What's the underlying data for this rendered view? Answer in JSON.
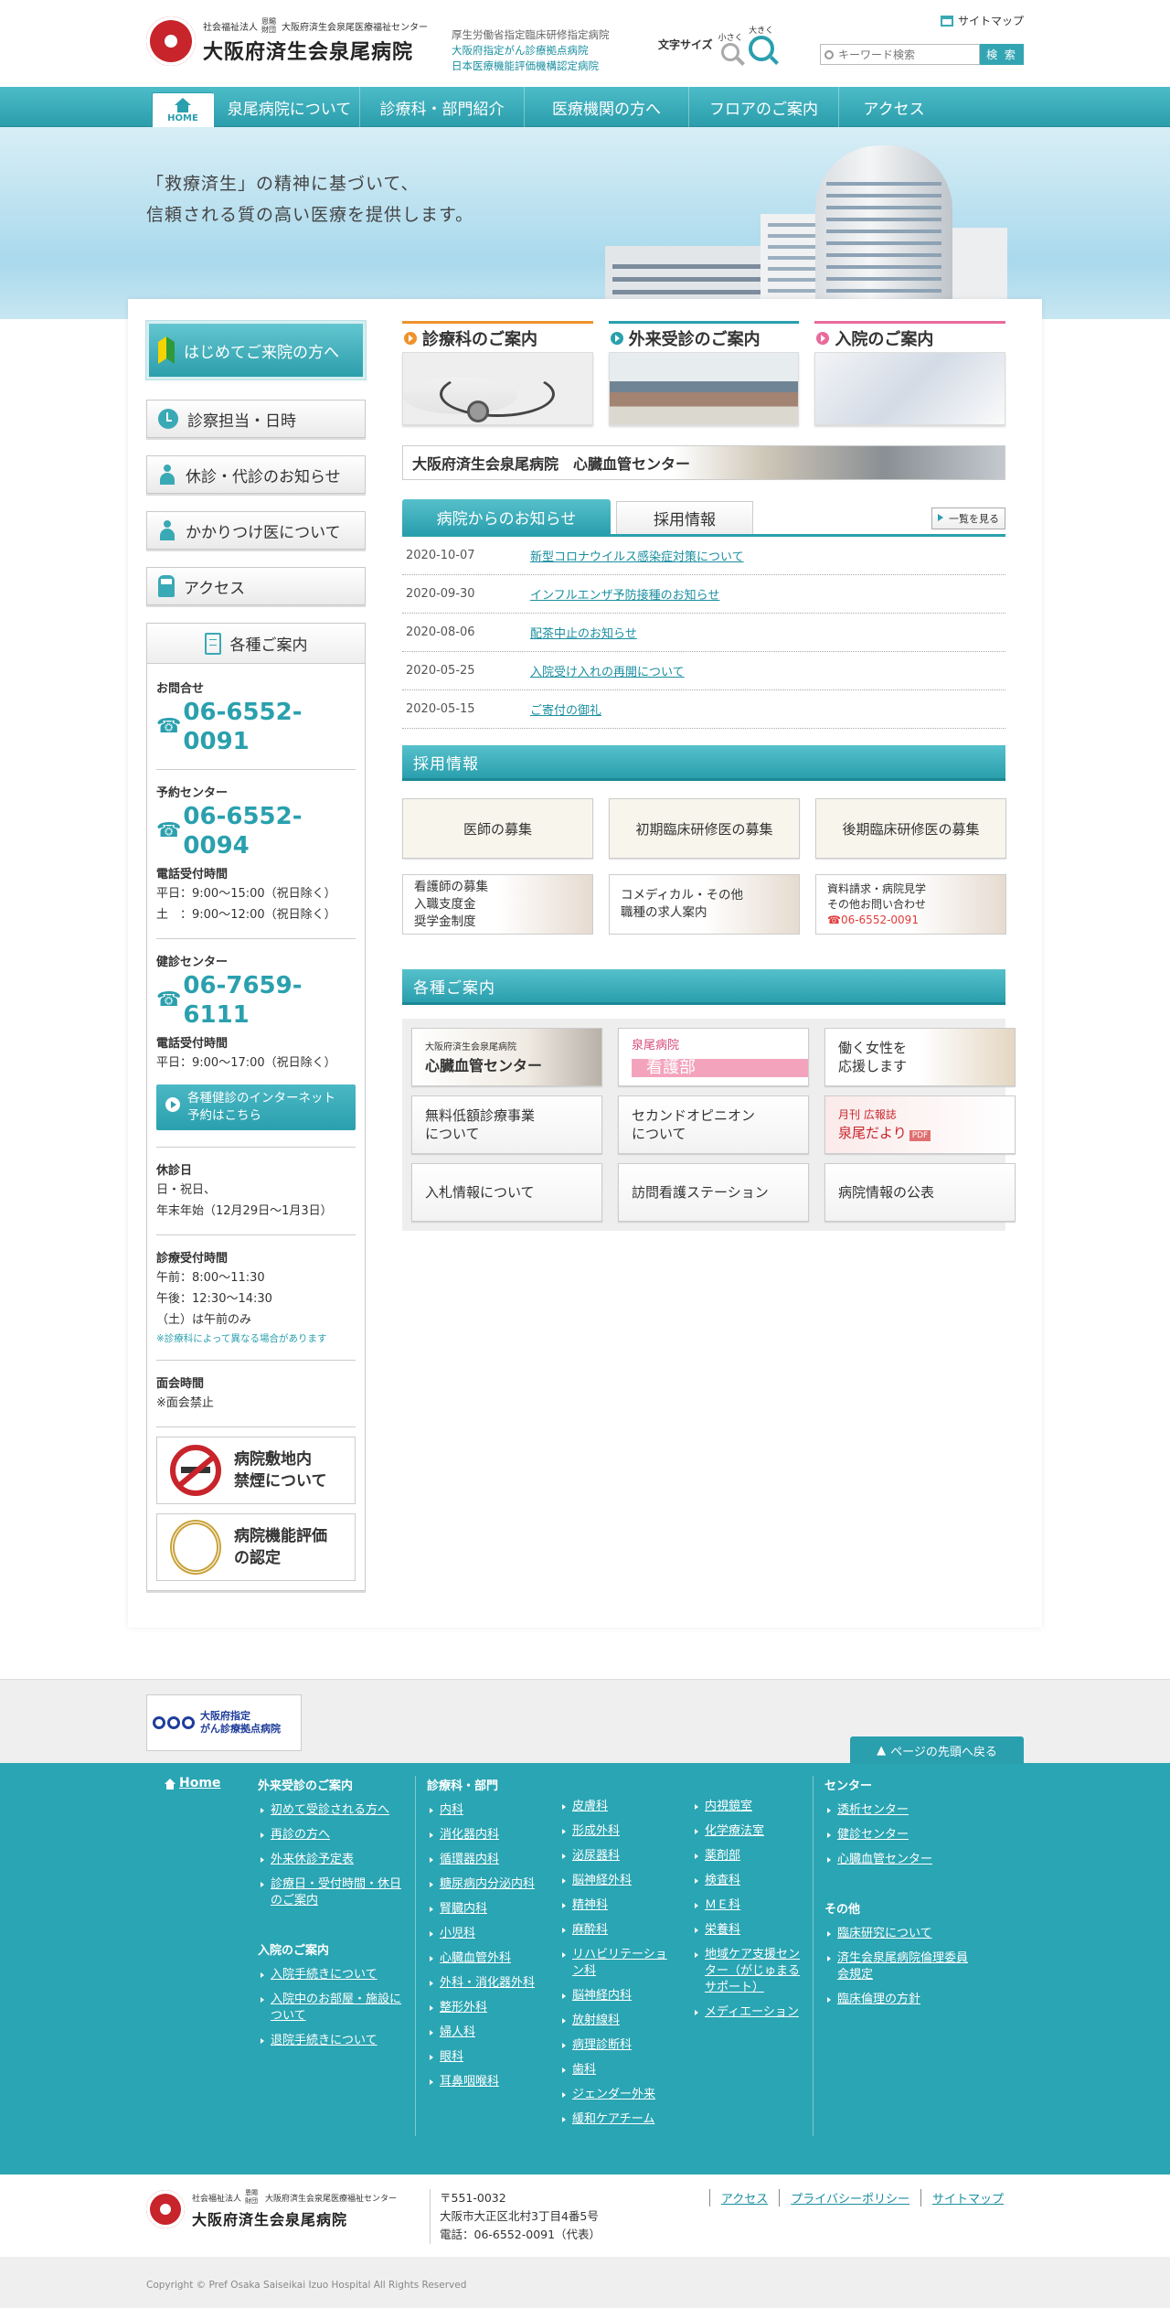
{
  "header": {
    "org_small": "社会福祉法人",
    "org_small2": "恩賜 財団",
    "org_center": "大阪府済生会泉尾医療福祉センター",
    "hospital_name": "大阪府済生会泉尾病院",
    "designations": [
      "厚生労働省指定臨床研修指定病院",
      "大阪府指定がん診療拠点病院",
      "日本医療機能評価機構認定病院"
    ],
    "sitemap": "サイトマップ",
    "font_size_label": "文字サイズ",
    "font_small": "小さく",
    "font_large": "大きく",
    "search_placeholder": "キーワード検索",
    "search_button": "検 索"
  },
  "nav": {
    "home": "HOME",
    "items": [
      "泉尾病院について",
      "診療科・部門紹介",
      "医療機関の方へ",
      "フロアのご案内",
      "アクセス"
    ]
  },
  "hero": {
    "line1": "「救療済生」の精神に基づいて、",
    "line2": "信頼される質の高い医療を提供します。"
  },
  "side": {
    "first_visit": "はじめてご来院の方へ",
    "buttons": [
      "診察担当・日時",
      "休診・代診のお知らせ",
      "かかりつけ医について",
      "アクセス"
    ],
    "info_title": "各種ご案内",
    "inquiry_label": "お問合せ",
    "inquiry_tel": "06-6552-0091",
    "reserve_label": "予約センター",
    "reserve_tel": "06-6552-0094",
    "reserve_hours_label": "電話受付時間",
    "reserve_hours_1": "平日：9:00～15:00（祝日除く）",
    "reserve_hours_2": "土　：9:00～12:00（祝日除く）",
    "checkup_label": "健診センター",
    "checkup_tel": "06-7659-6111",
    "checkup_hours_label": "電話受付時間",
    "checkup_hours_1": "平日：9:00～17:00（祝日除く）",
    "checkup_button_1": "各種健診のインターネット",
    "checkup_button_2": "予約はこちら",
    "closed_label": "休診日",
    "closed_1": "日・祝日、",
    "closed_2": "年末年始（12月29日～1月3日）",
    "reception_label": "診療受付時間",
    "reception_1": "午前：8:00～11:30",
    "reception_2": "午後：12:30～14:30",
    "reception_3": "（土）は午前のみ",
    "reception_note": "※診療科によって異なる場合があります",
    "visit_label": "面会時間",
    "visit_text": "※面会禁止",
    "nosmoke_1": "病院敷地内",
    "nosmoke_2": "禁煙について",
    "eval_1": "病院機能評価",
    "eval_2": "の認定"
  },
  "content": {
    "tri": [
      "診療科のご案内",
      "外来受診のご案内",
      "入院のご案内"
    ],
    "tri_colors": [
      "#f0922b",
      "#2aa0ae",
      "#e96a9c"
    ],
    "heart_banner": "大阪府済生会泉尾病院　心臓血管センター",
    "tab_news": "病院からのお知らせ",
    "tab_recruit": "採用情報",
    "more": "一覧を見る",
    "news": [
      {
        "date": "2020-10-07",
        "title": "新型コロナウイルス感染症対策について"
      },
      {
        "date": "2020-09-30",
        "title": "インフルエンザ予防接種のお知らせ"
      },
      {
        "date": "2020-08-06",
        "title": "配茶中止のお知らせ"
      },
      {
        "date": "2020-05-25",
        "title": "入院受け入れの再開について"
      },
      {
        "date": "2020-05-15",
        "title": "ご寄付の御礼"
      }
    ],
    "recruit_title": "採用情報",
    "recruit": [
      "医師の募集",
      "初期臨床研修医の募集",
      "後期臨床研修医の募集"
    ],
    "recruit_nurse": [
      "看護師の募集",
      "入職支度金",
      "奨学金制度"
    ],
    "recruit_comedical": [
      "コメディカル・その他",
      "職種の求人案内"
    ],
    "recruit_request": [
      "資料請求・病院見学",
      "その他お問い合わせ",
      "☎06-6552-0091"
    ],
    "guide_title": "各種ご案内",
    "guide_heart_small": "大阪府済生会泉尾病院",
    "guide_heart": "心臓血管センター",
    "guide_nurse_small": "泉尾病院",
    "guide_nurse": "看護部",
    "guide_work": [
      "働く女性を",
      "応援します"
    ],
    "guide_free": [
      "無料低額診療事業",
      "について"
    ],
    "guide_second": [
      "セカンドオピニオン",
      "について"
    ],
    "guide_pdf_small": "月刊 広報誌",
    "guide_pdf": "泉尾だより",
    "guide_pdf_badge": "PDF",
    "guide_row3": [
      "入札情報について",
      "訪問看護ステーション",
      "病院情報の公表"
    ]
  },
  "footer": {
    "osaka_1": "大阪府指定",
    "osaka_2": "がん診療拠点病院",
    "pagetop": "ページの先頭へ戻る",
    "home": "Home",
    "outpatient_title": "外来受診のご案内",
    "outpatient": [
      "初めて受診される方へ",
      "再診の方へ",
      "外来休診予定表",
      "診療日・受付時間・休日のご案内"
    ],
    "inpatient_title": "入院のご案内",
    "inpatient": [
      "入院手続きについて",
      "入院中のお部屋・施設について",
      "退院手続きについて"
    ],
    "dept_title": "診療科・部門",
    "dept_col1": [
      "内科",
      "消化器内科",
      "循環器内科",
      "糖尿病内分泌内科",
      "腎臓内科",
      "小児科",
      "心臓血管外科",
      "外科・消化器外科",
      "整形外科",
      "婦人科",
      "眼科",
      "耳鼻咽喉科"
    ],
    "dept_col2": [
      "皮膚科",
      "形成外科",
      "泌尿器科",
      "脳神経外科",
      "精神科",
      "麻酔科",
      "リハビリテーション科",
      "脳神経内科",
      "放射線科",
      "病理診断科",
      "歯科",
      "ジェンダー外来",
      "緩和ケアチーム"
    ],
    "dept_col3": [
      "内視鏡室",
      "化学療法室",
      "薬剤部",
      "検査科",
      "ＭＥ科",
      "栄養科",
      "地域ケア支援センター（がじゅまるサポート）",
      "メディエーション"
    ],
    "center_title": "センター",
    "centers": [
      "透析センター",
      "健診センター",
      "心臓血管センター"
    ],
    "other_title": "その他",
    "others": [
      "臨床研究について",
      "済生会泉尾病院倫理委員会規定",
      "臨床倫理の方針"
    ],
    "postal": "〒551-0032",
    "address": "大阪市大正区北村3丁目4番5号",
    "phone": "電話：06-6552-0091（代表）",
    "links": [
      "アクセス",
      "プライバシーポリシー",
      "サイトマップ"
    ],
    "copyright": "Copyright © Pref Osaka Saiseikai Izuo Hospital All Rights Reserved"
  }
}
